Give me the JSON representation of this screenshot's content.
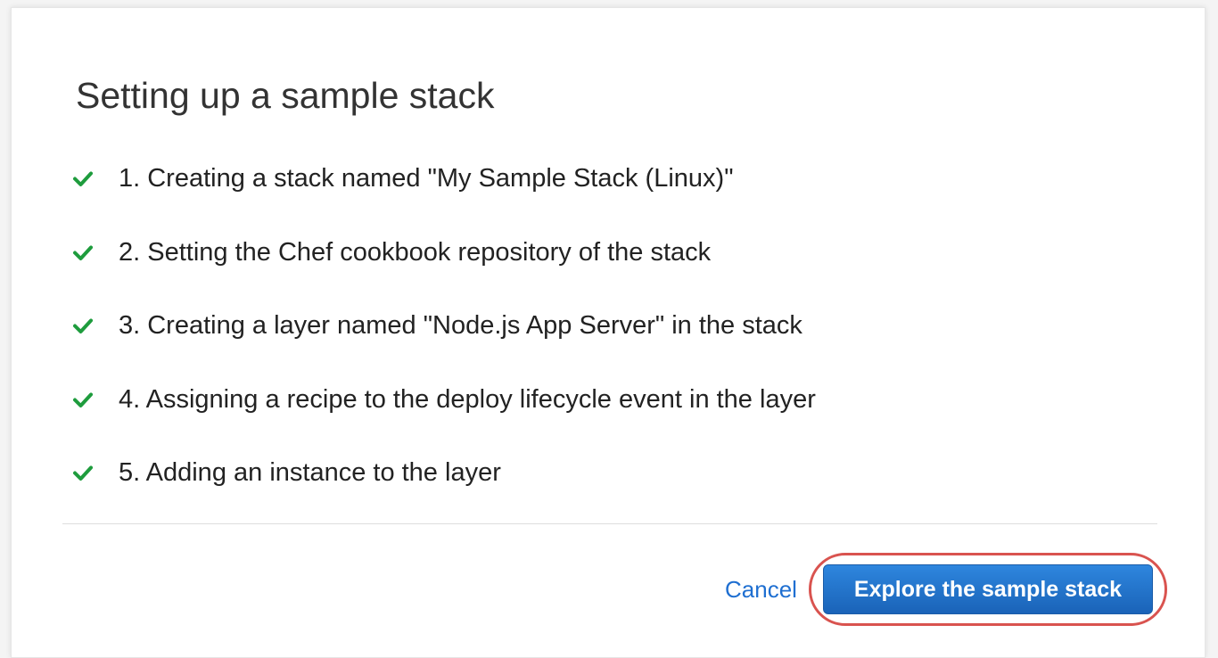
{
  "dialog": {
    "title": "Setting up a sample stack",
    "steps": [
      {
        "label": "1. Creating a stack named \"My Sample Stack (Linux)\"",
        "status": "done",
        "icon": "check-icon"
      },
      {
        "label": "2. Setting the Chef cookbook repository of the stack",
        "status": "done",
        "icon": "check-icon"
      },
      {
        "label": "3. Creating a layer named \"Node.js App Server\" in the stack",
        "status": "done",
        "icon": "check-icon"
      },
      {
        "label": "4. Assigning a recipe to the deploy lifecycle event in the layer",
        "status": "done",
        "icon": "check-icon"
      },
      {
        "label": "5. Adding an instance to the layer",
        "status": "done",
        "icon": "check-icon"
      }
    ],
    "actions": {
      "cancel_label": "Cancel",
      "primary_label": "Explore the sample stack"
    }
  },
  "colors": {
    "check": "#1e9c3d",
    "link": "#1f6fd1",
    "primary_button": "#1f6fc5",
    "highlight_ring": "#d9534f"
  }
}
